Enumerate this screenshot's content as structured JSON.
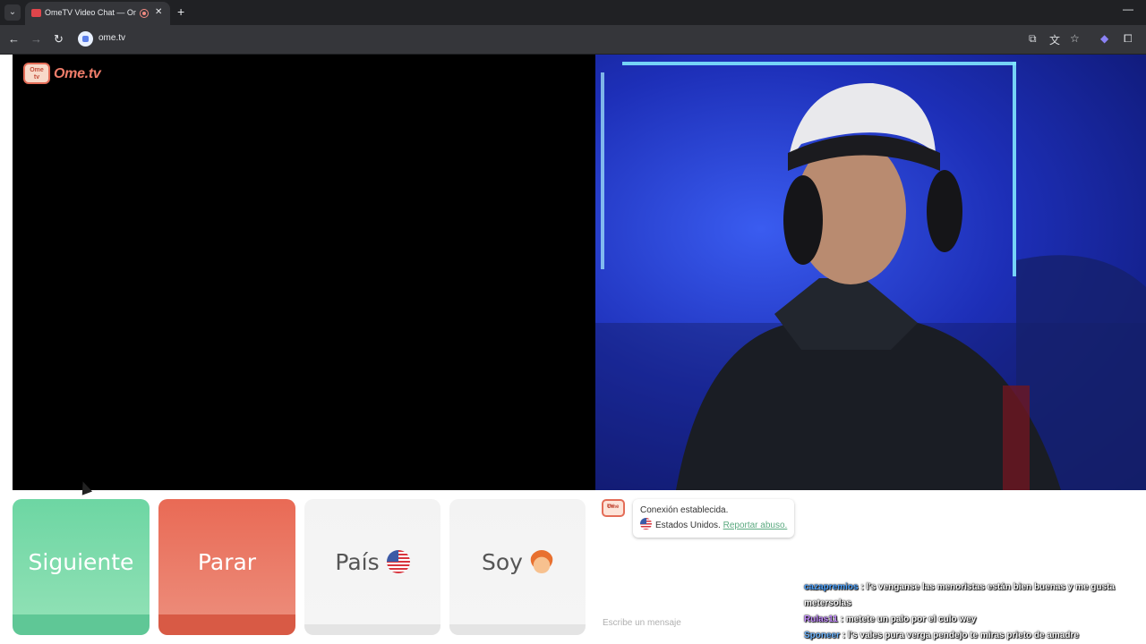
{
  "browser": {
    "tab_title": "OmeTV Video Chat — Ome",
    "url": "ome.tv"
  },
  "page": {
    "logo": {
      "badge_top": "Ome",
      "badge_bottom": "tv",
      "text": "Ome.tv"
    },
    "controls": {
      "next_label": "Siguiente",
      "stop_label": "Parar",
      "country_label": "País",
      "gender_label": "Soy"
    },
    "chat": {
      "badge_top": "Ome",
      "badge_bottom": "TV",
      "status": "Conexión establecida.",
      "country": "Estados Unidos.",
      "report_link": "Reportar abuso.",
      "input_placeholder": "Escribe un mensaje"
    }
  },
  "stream_overlay_chat": [
    {
      "user": "cazapremios",
      "text": ": l's venganse las menoristas están bien buenas y me gusta metersolas",
      "color": "#4da3ff"
    },
    {
      "user": "Rulas11",
      "text": ": metete un palo por el culo wey",
      "color": "#c58cff"
    },
    {
      "user": "Sponeer",
      "text": ": l's vales pura verga pendejo te miras prieto de amadre",
      "color": "#6fb6ff"
    }
  ]
}
